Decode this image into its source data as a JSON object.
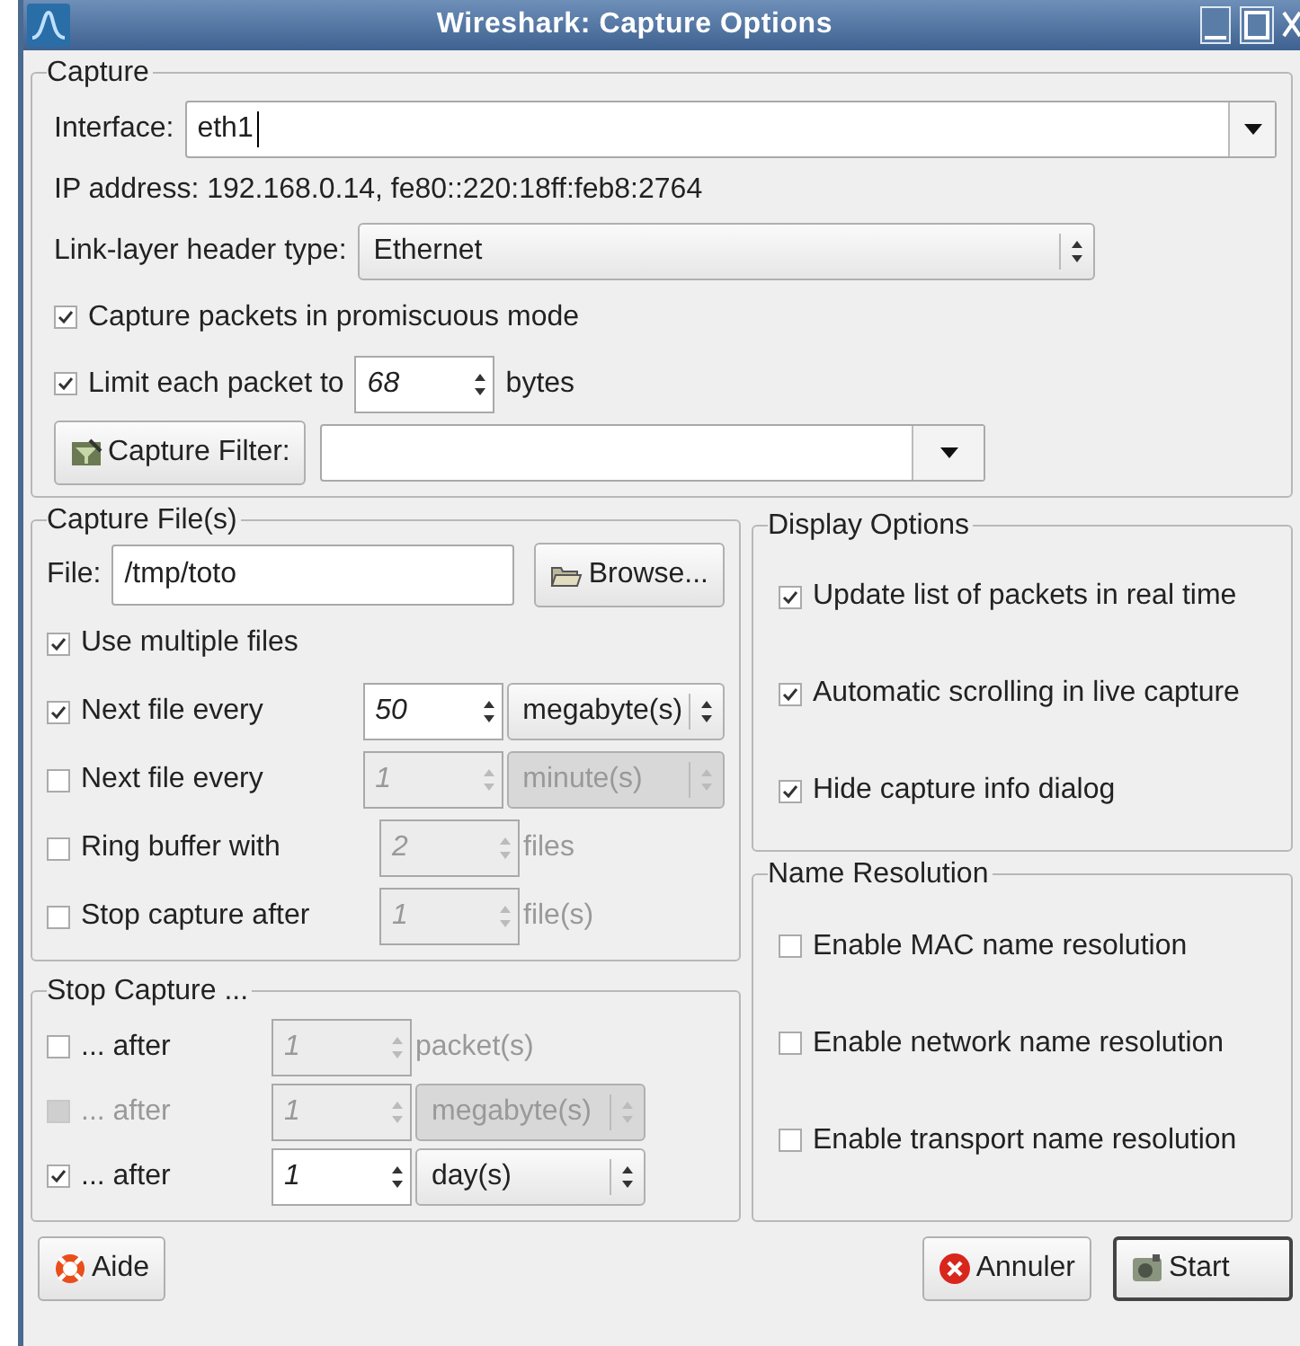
{
  "window": {
    "title": "Wireshark: Capture Options"
  },
  "capture": {
    "title": "Capture",
    "interface_label": "Interface:",
    "interface_value": "eth1",
    "ip_address": "IP address: 192.168.0.14, fe80::220:18ff:feb8:2764",
    "link_label": "Link-layer header type:",
    "link_value": "Ethernet",
    "promiscuous": {
      "label": "Capture packets in promiscuous mode",
      "checked": true
    },
    "limit": {
      "label": "Limit each packet to",
      "checked": true,
      "value": "68",
      "unit": "bytes"
    },
    "filter_button": "Capture Filter:"
  },
  "capture_files": {
    "title": "Capture File(s)",
    "file_label": "File:",
    "file_value": "/tmp/toto",
    "browse_button": "Browse...",
    "multiple": {
      "label": "Use multiple files",
      "checked": true
    },
    "rows": [
      {
        "label": "Next file every",
        "checked": true,
        "disabled": false,
        "input_disabled": false,
        "value": "50",
        "kind": "select",
        "unit": "megabyte(s)"
      },
      {
        "label": "Next file every",
        "checked": false,
        "disabled": false,
        "input_disabled": true,
        "value": "1",
        "kind": "select",
        "unit": "minute(s)"
      },
      {
        "label": "Ring buffer with",
        "checked": false,
        "disabled": false,
        "input_disabled": true,
        "value": "2",
        "kind": "text",
        "unit": "files"
      },
      {
        "label": "Stop capture after",
        "checked": false,
        "disabled": false,
        "input_disabled": true,
        "value": "1",
        "kind": "text",
        "unit": "file(s)"
      }
    ]
  },
  "stop_capture": {
    "title": "Stop Capture ...",
    "rows": [
      {
        "label": "... after",
        "checked": false,
        "disabled": false,
        "input_disabled": true,
        "value": "1",
        "kind": "text",
        "unit": "packet(s)"
      },
      {
        "label": "... after",
        "checked": false,
        "disabled": true,
        "input_disabled": true,
        "value": "1",
        "kind": "select",
        "unit": "megabyte(s)"
      },
      {
        "label": "... after",
        "checked": true,
        "disabled": false,
        "input_disabled": false,
        "value": "1",
        "kind": "select",
        "unit": "day(s)"
      }
    ]
  },
  "display_options": {
    "title": "Display Options",
    "items": [
      {
        "label": "Update list of packets in real time",
        "checked": true
      },
      {
        "label": "Automatic scrolling in live capture",
        "checked": true
      },
      {
        "label": "Hide capture info dialog",
        "checked": true
      }
    ]
  },
  "name_resolution": {
    "title": "Name Resolution",
    "items": [
      {
        "label": "Enable MAC name resolution",
        "checked": false
      },
      {
        "label": "Enable network name resolution",
        "checked": false
      },
      {
        "label": "Enable transport name resolution",
        "checked": false
      }
    ]
  },
  "buttons": [
    {
      "label": "Aide",
      "kind": "help",
      "default": false
    },
    {
      "label": "Annuler",
      "kind": "cancel",
      "default": false
    },
    {
      "label": "Start",
      "kind": "start",
      "default": true
    }
  ]
}
